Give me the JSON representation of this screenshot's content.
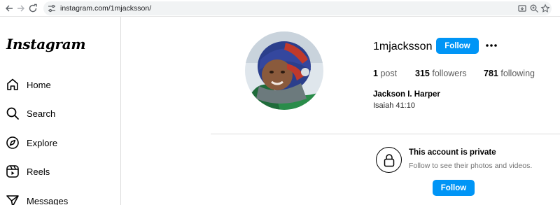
{
  "browser": {
    "url": "instagram.com/1mjacksson/",
    "icons": [
      "back-arrow-icon",
      "forward-arrow-icon",
      "reload-icon",
      "site-info-icon",
      "install-app-icon",
      "zoom-icon",
      "bookmark-star-icon"
    ]
  },
  "sidebar": {
    "logo": "Instagram",
    "items": [
      {
        "label": "Home",
        "icon": "home-icon"
      },
      {
        "label": "Search",
        "icon": "search-icon"
      },
      {
        "label": "Explore",
        "icon": "compass-icon"
      },
      {
        "label": "Reels",
        "icon": "reels-icon"
      },
      {
        "label": "Messages",
        "icon": "send-icon"
      }
    ]
  },
  "profile": {
    "username": "1mjacksson",
    "follow_label": "Follow",
    "more_icon": "more-options-icon",
    "stats": {
      "posts_count": "1",
      "posts_label": "post",
      "followers_count": "315",
      "followers_label": "followers",
      "following_count": "781",
      "following_label": "following"
    },
    "full_name": "Jackson I. Harper",
    "bio": "Isaiah 41:10"
  },
  "private": {
    "icon": "lock-icon",
    "title": "This account is private",
    "subtitle": "Follow to see their photos and videos.",
    "follow_label": "Follow"
  },
  "colors": {
    "accent": "#0095f6",
    "divider": "#dbdbdb",
    "muted_text": "#737373"
  }
}
